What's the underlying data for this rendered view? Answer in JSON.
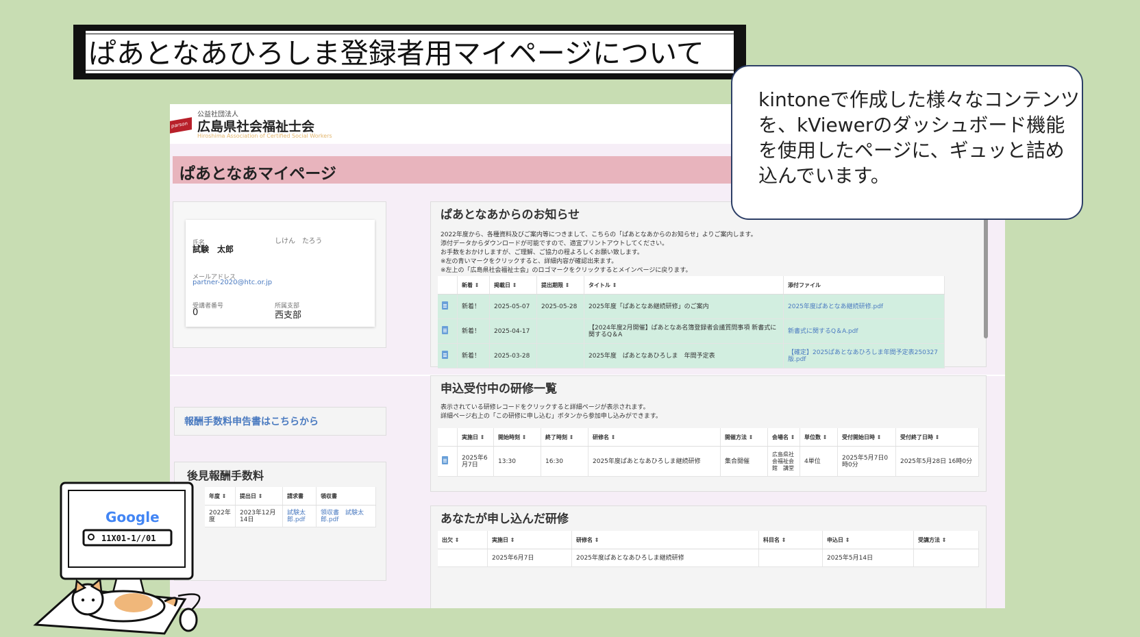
{
  "slide": {
    "title": "ぱあとなあひろしま登録者用マイページについて",
    "bubble": "kintoneで作成した様々なコンテンツを、kViewerのダッシュボード機能を使用したページに、ギュッと詰め込んでいます。"
  },
  "site": {
    "logo_small": "公益社団法人",
    "logo_main": "広島県社会福祉士会",
    "logo_en": "Hiroshima Association of Certified Social Workers",
    "logo_mark": "parson",
    "page_title": "ぱあとなあマイページ"
  },
  "profile": {
    "name_label": "氏名",
    "name": "試験　太郎",
    "kana": "しけん　たろう",
    "email_label": "メールアドレス",
    "email": "partner-2020@htc.or.jp",
    "student_no_label": "受講者番号",
    "student_no": "0",
    "branch_label": "所属支部",
    "branch": "西支部"
  },
  "fee_link": "報酬手数料申告書はこちらから",
  "guardian": {
    "heading": "後見報酬手数料",
    "columns": [
      "年度 ⇕",
      "提出日 ⇕",
      "請求書",
      "領収書"
    ],
    "rows": [
      [
        "2022年度",
        "2023年12月14日",
        "試験太郎.pdf",
        "領収書　試験太郎.pdf"
      ]
    ]
  },
  "notice": {
    "heading": "ぱあとなあからのお知らせ",
    "lines": [
      "2022年度から、各種資料及びご案内等につきまして、こちらの「ぱあとなあからのお知らせ」よりご案内します。",
      "添付データからダウンロードが可能ですので、適宜プリントアウトしてください。",
      "お手数をおかけしますが、ご理解、ご協力の程よろしくお願い致します。",
      "※左の青いマークをクリックすると、詳細内容が確認出来ます。",
      "※左上の「広島県社会福祉士会」のロゴマークをクリックするとメインページに戻ります。"
    ],
    "columns": [
      "新着 ⇕",
      "掲載日 ⇕",
      "提出期限 ⇕",
      "タイトル ⇕",
      "添付ファイル"
    ],
    "rows": [
      {
        "new": "新着！",
        "date": "2025-05-07",
        "deadline": "2025-05-28",
        "title": "2025年度「ぱあとなあ継続研修」のご案内",
        "file": "2025年度ぱあとなあ継続研修.pdf"
      },
      {
        "new": "新着！",
        "date": "2025-04-17",
        "deadline": "",
        "title": "【2024年度2月開催】ぱあとなあ名簿登録者会議質問事項 新書式に関するQ＆A",
        "file": "新書式に関するQ＆A.pdf"
      },
      {
        "new": "新着！",
        "date": "2025-03-28",
        "deadline": "",
        "title": "2025年度　ぱあとなあひろしま　年間予定表",
        "file": "【確定】2025ぱあとなあひろしま年間予定表250327版.pdf"
      }
    ]
  },
  "training": {
    "heading": "申込受付中の研修一覧",
    "lines": [
      "表示されている研修レコードをクリックすると詳細ページが表示されます。",
      "詳細ページ右上の「この研修に申し込む」ボタンから参加申し込みができます。"
    ],
    "columns": [
      "実施日 ⇕",
      "開始時刻 ⇕",
      "終了時刻 ⇕",
      "研修名 ⇕",
      "開催方法 ⇕",
      "会場名 ⇕",
      "単位数 ⇕",
      "受付開始日時 ⇕",
      "受付終了日時 ⇕"
    ],
    "rows": [
      [
        "2025年6月7日",
        "13:30",
        "16:30",
        "2025年度ぱあとなあひろしま継続研修",
        "集合開催",
        "広島県社会福祉会館　講堂",
        "4単位",
        "2025年5月7日0時0分",
        "2025年5月28日 16時0分"
      ]
    ]
  },
  "applied": {
    "heading": "あなたが申し込んだ研修",
    "columns": [
      "出欠 ⇕",
      "実施日 ⇕",
      "研修名 ⇕",
      "科目名 ⇕",
      "申込日 ⇕",
      "受講方法 ⇕"
    ],
    "rows": [
      [
        "",
        "2025年6月7日",
        "2025年度ぱあとなあひろしま継続研修",
        "",
        "2025年5月14日",
        ""
      ]
    ]
  },
  "illustration": {
    "logo": "Google",
    "search_text": "11X01-1//01"
  }
}
